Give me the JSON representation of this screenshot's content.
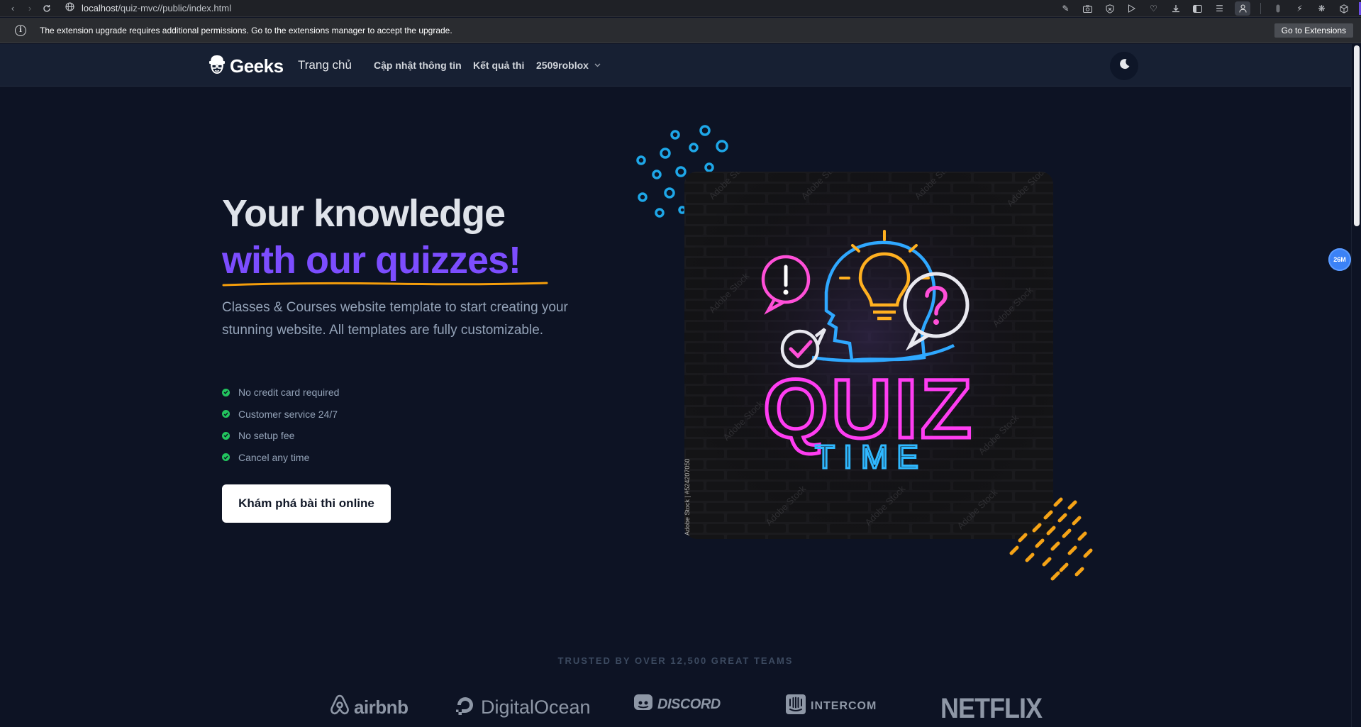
{
  "browser": {
    "url_host": "localhost",
    "url_path": "/quiz-mvc//public/index.html"
  },
  "extension_bar": {
    "message": "The extension upgrade requires additional permissions. Go to the extensions manager to accept the upgrade.",
    "button_label": "Go to Extensions"
  },
  "header": {
    "logo_text": "Geeks",
    "nav": {
      "home": "Trang chủ",
      "update_info": "Cập nhật thông tin",
      "results": "Kết quả thi",
      "user": "2509roblox"
    }
  },
  "hero": {
    "title_line1": "Your knowledge",
    "title_line2": "with our quizzes!",
    "description": "Classes & Courses website template to start creating your stunning website. All templates are fully customizable.",
    "features": [
      "No credit card required",
      "Customer service 24/7",
      "No setup fee",
      "Cancel any time"
    ],
    "cta_label": "Khám phá bài thi online"
  },
  "image": {
    "title_top": "QUIZ",
    "title_bottom": "TIME",
    "watermark": "Adobe Stock | #524207050",
    "stock_mark": "Adobe Stock"
  },
  "floating_badge": "26M",
  "trusted": {
    "heading": "TRUSTED BY OVER 12,500 GREAT TEAMS",
    "brands": [
      "airbnb",
      "DigitalOcean",
      "DISCORD",
      "INTERCOM",
      "NETFLIX"
    ]
  },
  "colors": {
    "accent_purple": "#7c4dff",
    "underline_orange": "#f59e0b",
    "check_green": "#22c55e",
    "bg": "#0d1324"
  }
}
